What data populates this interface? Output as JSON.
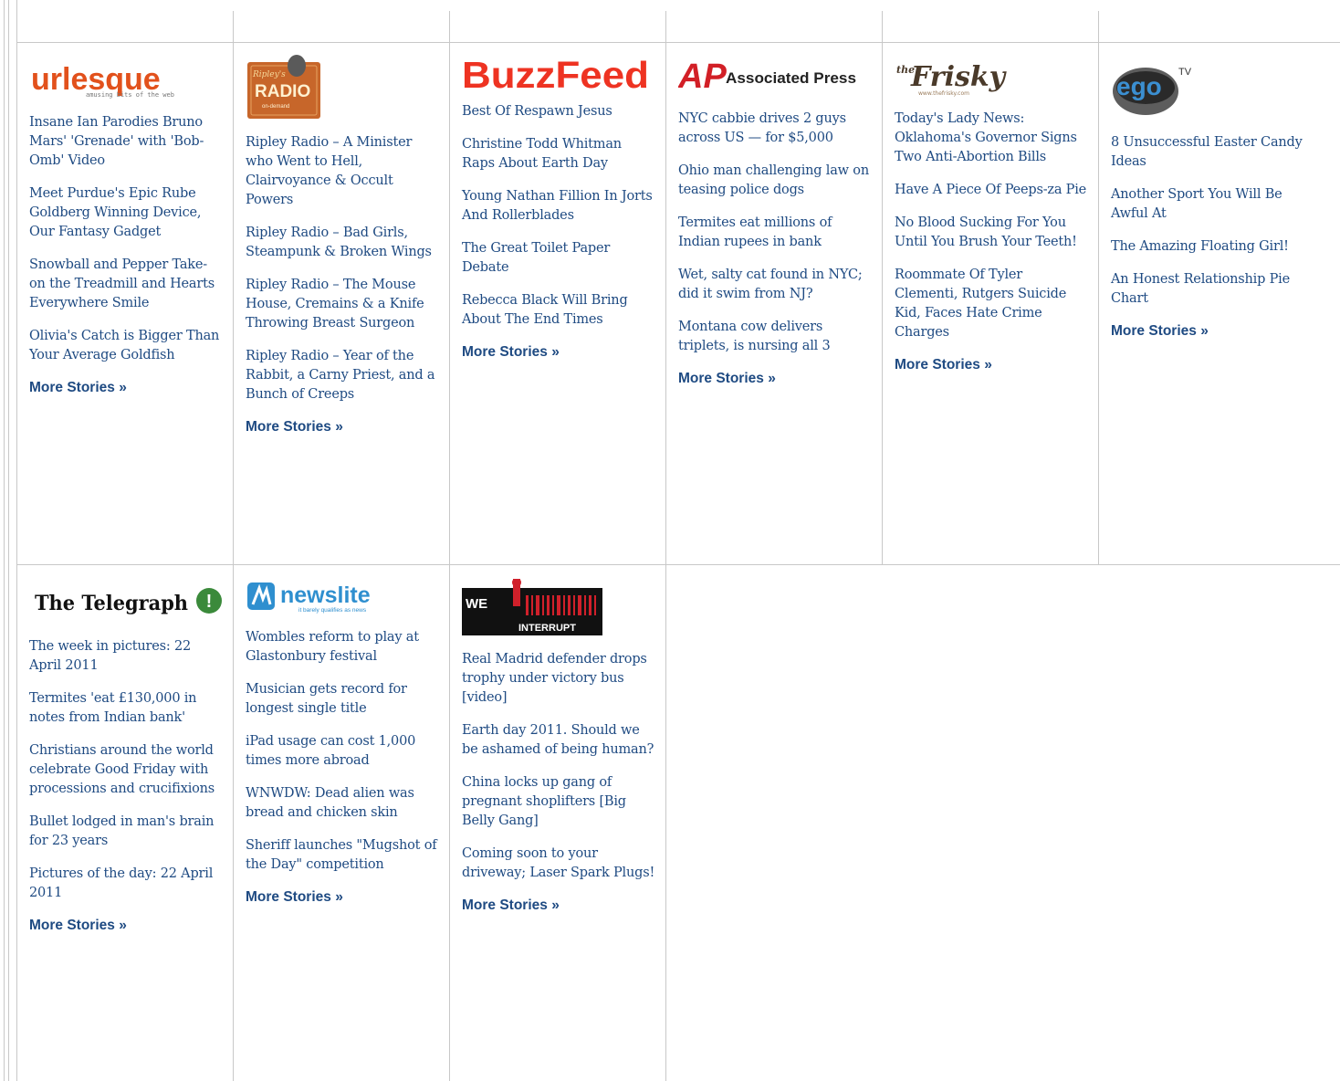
{
  "more_label": "More Stories »",
  "colors": {
    "link": "#1e4a82",
    "border": "#c8c8c8"
  },
  "sources": [
    {
      "name": "urlesque",
      "logo": {
        "text": "urlesque",
        "tagline": "amusing bits of the web"
      },
      "stories": [
        "Insane Ian Parodies Bruno Mars' 'Grenade' with 'Bob-Omb' Video",
        "Meet Purdue's Epic Rube Goldberg Winning Device, Our Fantasy Gadget",
        "Snowball and Pepper Take-on the Treadmill and Hearts Everywhere Smile",
        "Olivia's Catch is Bigger Than Your Average Goldfish"
      ]
    },
    {
      "name": "ripley-radio",
      "logo": {
        "script": "Ripley's",
        "text": "RADIO",
        "tagline": "on-demand"
      },
      "stories": [
        "Ripley Radio – A Minister who Went to Hell, Clairvoyance & Occult Powers",
        "Ripley Radio – Bad Girls, Steampunk & Broken Wings",
        "Ripley Radio – The Mouse House, Cremains & a Knife Throwing Breast Surgeon",
        "Ripley Radio – Year of the Rabbit, a Carny Priest, and a Bunch of Creeps"
      ]
    },
    {
      "name": "buzzfeed",
      "logo": {
        "text": "BuzzFeed"
      },
      "stories": [
        "Best Of Respawn Jesus",
        "Christine Todd Whitman Raps About Earth Day",
        "Young Nathan Fillion In Jorts And Rollerblades",
        "The Great Toilet Paper Debate",
        "Rebecca Black Will Bring About The End Times"
      ]
    },
    {
      "name": "associated-press",
      "logo": {
        "mark": "AP",
        "text": "Associated Press"
      },
      "stories": [
        "NYC cabbie drives 2 guys across US — for $5,000",
        "Ohio man challenging law on teasing police dogs",
        "Termites eat millions of Indian rupees in bank",
        "Wet, salty cat found in NYC; did it swim from NJ?",
        "Montana cow delivers triplets, is nursing all 3"
      ]
    },
    {
      "name": "the-frisky",
      "logo": {
        "small": "the",
        "text": "Frisky",
        "url": "www.thefrisky.com"
      },
      "stories": [
        "Today's Lady News: Oklahoma's Governor Signs Two Anti-Abortion Bills",
        "Have A Piece Of Peeps-za Pie",
        "No Blood Sucking For You Until You Brush Your Teeth!",
        "Roommate Of Tyler Clementi, Rutgers Suicide Kid, Faces Hate Crime Charges"
      ]
    },
    {
      "name": "ego-tv",
      "logo": {
        "text": "ego",
        "sup": "TV"
      },
      "stories": [
        "8 Unsuccessful Easter Candy Ideas",
        "Another Sport You Will Be Awful At",
        "The Amazing Floating Girl!",
        "An Honest Relationship Pie Chart"
      ]
    },
    {
      "name": "the-telegraph",
      "logo": {
        "text": "The Telegraph",
        "badge": "!"
      },
      "stories": [
        "The week in pictures: 22 April 2011",
        "Termites 'eat £130,000 in notes from Indian bank'",
        "Christians around the world celebrate Good Friday with processions and crucifixions",
        "Bullet lodged in man's brain for 23 years",
        "Pictures of the day: 22 April 2011"
      ]
    },
    {
      "name": "newslite",
      "logo": {
        "text": "newslite",
        "tagline": "it barely qualifies as news"
      },
      "stories": [
        "Wombles reform to play at Glastonbury festival",
        "Musician gets record for longest single title",
        "iPad usage can cost 1,000 times more abroad",
        "WNWDW: Dead alien was bread and chicken skin",
        "Sheriff launches \"Mugshot of the Day\" competition"
      ]
    },
    {
      "name": "we-interrupt",
      "logo": {
        "text1": "WE",
        "text2": "INTERRUPT"
      },
      "stories": [
        "Real Madrid defender drops trophy under victory bus [video]",
        "Earth day 2011. Should we be ashamed of being human?",
        "China locks up gang of pregnant shoplifters [Big Belly Gang]",
        "Coming soon to your driveway; Laser Spark Plugs!"
      ]
    }
  ]
}
